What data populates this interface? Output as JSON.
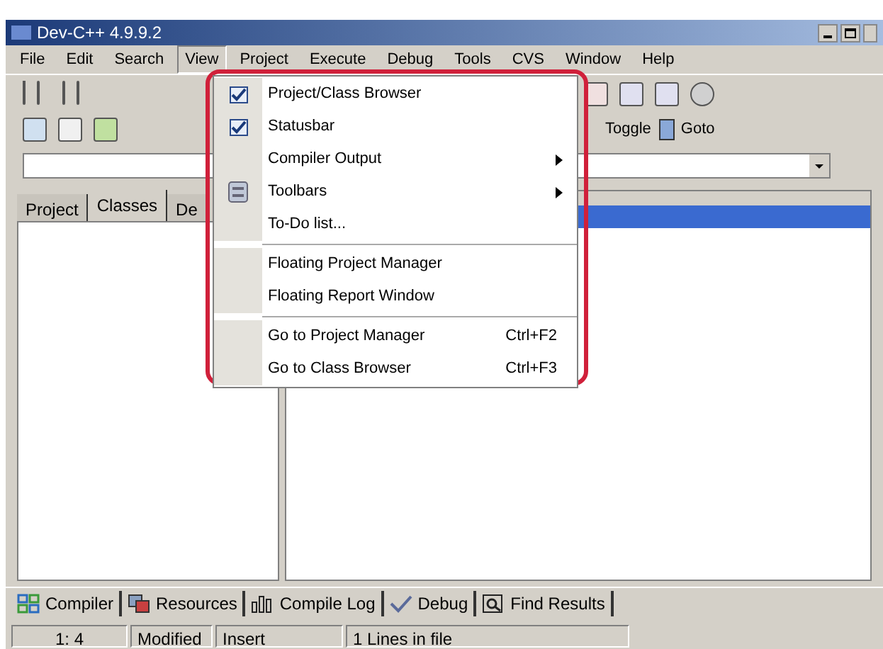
{
  "window": {
    "title": "Dev-C++ 4.9.9.2"
  },
  "menu_bar": [
    {
      "label": "File",
      "selected": false
    },
    {
      "label": "Edit",
      "selected": false
    },
    {
      "label": "Search",
      "selected": false
    },
    {
      "label": "View",
      "selected": true
    },
    {
      "label": "Project",
      "selected": false
    },
    {
      "label": "Execute",
      "selected": false
    },
    {
      "label": "Debug",
      "selected": false
    },
    {
      "label": "Tools",
      "selected": false
    },
    {
      "label": "CVS",
      "selected": false
    },
    {
      "label": "Window",
      "selected": false
    },
    {
      "label": "Help",
      "selected": false
    }
  ],
  "toolbar_buttons": [
    {
      "label": "Toggle"
    },
    {
      "label": "Goto"
    }
  ],
  "left_tabs": [
    {
      "label": "Project",
      "selected": false
    },
    {
      "label": "Classes",
      "selected": true
    },
    {
      "label": "De",
      "selected": false
    }
  ],
  "view_menu": [
    {
      "kind": "check",
      "label": "Project/Class Browser",
      "checked": true
    },
    {
      "kind": "check",
      "label": "Statusbar",
      "checked": true
    },
    {
      "kind": "submenu",
      "label": "Compiler Output"
    },
    {
      "kind": "submenu_icon",
      "label": "Toolbars"
    },
    {
      "kind": "item",
      "label": "To-Do list..."
    },
    {
      "kind": "separator"
    },
    {
      "kind": "item",
      "label": "Floating Project Manager"
    },
    {
      "kind": "item",
      "label": "Floating Report Window"
    },
    {
      "kind": "separator"
    },
    {
      "kind": "shortcut",
      "label": "Go to Project Manager",
      "shortcut": "Ctrl+F2"
    },
    {
      "kind": "shortcut",
      "label": "Go to Class Browser",
      "shortcut": "Ctrl+F3"
    }
  ],
  "bottom_tabs": [
    {
      "label": "Compiler"
    },
    {
      "label": "Resources"
    },
    {
      "label": "Compile Log"
    },
    {
      "label": "Debug"
    },
    {
      "label": "Find Results"
    }
  ],
  "status_bar": [
    "1: 4",
    "Modified",
    "Insert",
    "1 Lines in file"
  ]
}
